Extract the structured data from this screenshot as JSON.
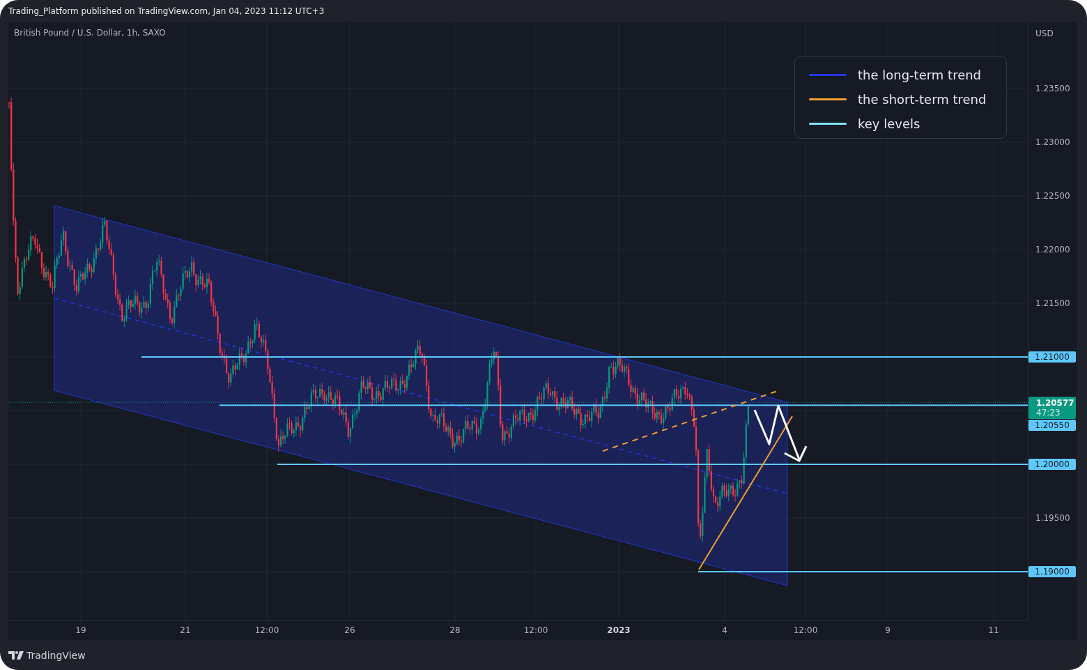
{
  "header": {
    "title": "Trading_Platform published on TradingView.com, Jan 04, 2023 11:12 UTC+3"
  },
  "chart": {
    "symbol": "British Pound / U.S. Dollar, 1h, SAXO",
    "currency": "USD",
    "legend": [
      {
        "label": "the long-term trend",
        "color": "#2536e8"
      },
      {
        "label": "the short-term trend",
        "color": "#f0a030"
      },
      {
        "label": "key levels",
        "color": "#7fe3f5"
      }
    ],
    "price_axis": [
      {
        "text": "1.23500",
        "kind": "tick"
      },
      {
        "text": "1.23000",
        "kind": "tick"
      },
      {
        "text": "1.22500",
        "kind": "tick"
      },
      {
        "text": "1.22000",
        "kind": "tick"
      },
      {
        "text": "1.21500",
        "kind": "tick"
      },
      {
        "text": "1.21000",
        "kind": "level"
      },
      {
        "text": "1.20577",
        "kind": "current",
        "countdown": "47:23"
      },
      {
        "text": "1.20550",
        "kind": "level"
      },
      {
        "text": "1.20000",
        "kind": "level"
      },
      {
        "text": "1.19500",
        "kind": "tick"
      },
      {
        "text": "1.19000",
        "kind": "level"
      }
    ],
    "time_axis": [
      {
        "text": "19",
        "kind": "day"
      },
      {
        "text": "21",
        "kind": "day"
      },
      {
        "text": "12:00",
        "kind": "time"
      },
      {
        "text": "26",
        "kind": "day"
      },
      {
        "text": "28",
        "kind": "day"
      },
      {
        "text": "12:00",
        "kind": "time"
      },
      {
        "text": "2023",
        "kind": "year"
      },
      {
        "text": "4",
        "kind": "day"
      },
      {
        "text": "12:00",
        "kind": "time"
      },
      {
        "text": "9",
        "kind": "day"
      },
      {
        "text": "11",
        "kind": "day"
      }
    ]
  },
  "footer": {
    "brand": "TradingView"
  }
}
